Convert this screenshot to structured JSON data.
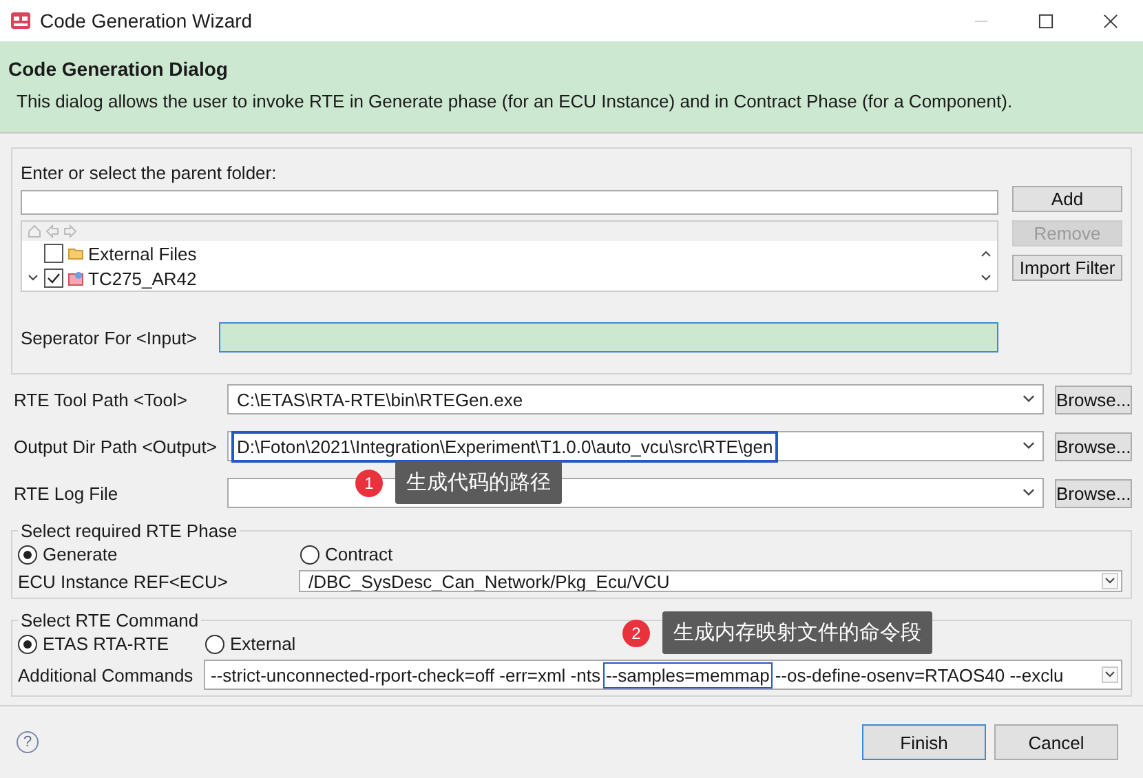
{
  "window": {
    "title": "Code Generation Wizard"
  },
  "header": {
    "title": "Code Generation Dialog",
    "description": "This dialog allows the user to invoke RTE in Generate phase (for an ECU Instance) and in Contract Phase (for a Component)."
  },
  "folder_section": {
    "label": "Enter or select the parent folder:",
    "tree": [
      {
        "kind": "folder",
        "label": "External Files",
        "checked": false
      },
      {
        "kind": "project",
        "label": "TC275_AR42",
        "checked": true,
        "expanded": true
      }
    ],
    "buttons": [
      {
        "label": "Add",
        "disabled": false
      },
      {
        "label": "Remove",
        "disabled": true
      },
      {
        "label": "Import Filter",
        "disabled": false
      }
    ],
    "separator": {
      "label": "Seperator For <Input>",
      "focused": true
    }
  },
  "paths": [
    {
      "label": "RTE Tool Path <Tool>",
      "value": "C:\\ETAS\\RTA-RTE\\bin\\RTEGen.exe",
      "button": "Browse..."
    },
    {
      "label": "Output Dir Path <Output>",
      "value": "D:\\Foton\\2021\\Integration\\Experiment\\T1.0.0\\auto_vcu\\src\\RTE\\gen",
      "highlighted": true,
      "button": "Browse..."
    },
    {
      "label": "RTE Log File",
      "button": "Browse..."
    }
  ],
  "phase_group": {
    "legend": "Select required RTE Phase",
    "options": [
      {
        "label": "Generate",
        "selected": true
      },
      {
        "label": "Contract",
        "selected": false
      }
    ],
    "ecu_label": "ECU Instance REF<ECU>",
    "ecu_value": "/DBC_SysDesc_Can_Network/Pkg_Ecu/VCU"
  },
  "command_group": {
    "legend": "Select RTE Command",
    "options": [
      {
        "label": "ETAS RTA-RTE",
        "selected": true
      },
      {
        "label": "External",
        "selected": false
      }
    ],
    "commands_label": "Additional Commands",
    "command_parts": [
      {
        "text": "--strict-unconnected-rport-check=off -err=xml -nts",
        "highlighted": false
      },
      {
        "text": "--samples=memmap",
        "highlighted": true
      },
      {
        "text": "--os-define-osenv=RTAOS40 --exclu",
        "highlighted": false
      }
    ]
  },
  "help": "?",
  "footer_buttons": [
    {
      "label": "Finish",
      "default": true
    },
    {
      "label": "Cancel",
      "default": false
    }
  ],
  "annotations": [
    {
      "number": "1",
      "text": "生成代码的路径"
    },
    {
      "number": "2",
      "text": "生成内存映射文件的命令段"
    }
  ]
}
